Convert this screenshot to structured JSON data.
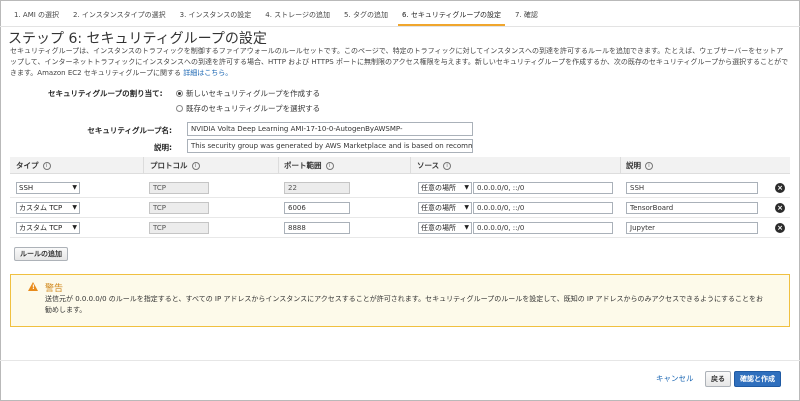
{
  "wizard": {
    "steps": [
      "1. AMI の選択",
      "2. インスタンスタイプの選択",
      "3. インスタンスの設定",
      "4. ストレージの追加",
      "5. タグの追加",
      "6. セキュリティグループの設定",
      "7. 確認"
    ],
    "active_step": 5
  },
  "page": {
    "title": "ステップ 6: セキュリティグループの設定",
    "description": "セキュリティグループは、インスタンスのトラフィックを制御するファイアウォールのルールセットです。このページで、特定のトラフィックに対してインスタンスへの到達を許可するルールを追加できます。たとえば、ウェブサーバーをセットアップして、インターネットトラフィックにインスタンスへの到達を許可する場合、HTTP および HTTPS ポートに無制限のアクセス権限を与えます。新しいセキュリティグループを作成するか、次の既存のセキュリティグループから選択することができます。Amazon EC2 セキュリティグループに関する",
    "details_link": "詳細はこちら。"
  },
  "assign": {
    "label": "セキュリティグループの割り当て:",
    "option_new": "新しいセキュリティグループを作成する",
    "option_existing": "既存のセキュリティグループを選択する",
    "selected": "new"
  },
  "form": {
    "name_label": "セキュリティグループ名:",
    "name_value": "NVIDIA Volta Deep Learning AMI-17-10-0-AutogenByAWSMP-",
    "desc_label": "説明:",
    "desc_value": "This security group was generated by AWS Marketplace and is based on recomm"
  },
  "table": {
    "headers": {
      "type": "タイプ",
      "protocol": "プロトコル",
      "port_range": "ポート範囲",
      "source": "ソース",
      "description": "説明"
    },
    "info_icon": "i",
    "rows": [
      {
        "type": "SSH",
        "protocol": "TCP",
        "port": "22",
        "source_type": "任意の場所",
        "cidr": "0.0.0.0/0, ::/0",
        "description": "SSH"
      },
      {
        "type": "カスタム TCP",
        "protocol": "TCP",
        "port": "6006",
        "source_type": "任意の場所",
        "cidr": "0.0.0.0/0, ::/0",
        "description": "TensorBoard"
      },
      {
        "type": "カスタム TCP",
        "protocol": "TCP",
        "port": "8888",
        "source_type": "任意の場所",
        "cidr": "0.0.0.0/0, ::/0",
        "description": "Jupyter"
      }
    ],
    "add_rule": "ルールの追加"
  },
  "warning": {
    "title": "警告",
    "text": "送信元が 0.0.0.0/0 のルールを指定すると、すべての IP アドレスからインスタンスにアクセスすることが許可されます。セキュリティグループのルールを設定して、既知の IP アドレスからのみアクセスできるようにすることをお勧めします。"
  },
  "footer": {
    "cancel": "キャンセル",
    "back": "戻る",
    "review": "確認と作成"
  },
  "colors": {
    "accent": "#f0a62d",
    "link": "#1a66b3",
    "primary_button": "#2f6fbd",
    "warning_title": "#d0871b",
    "warning_bg": "#fdfaea",
    "warning_border": "#f0c040"
  }
}
